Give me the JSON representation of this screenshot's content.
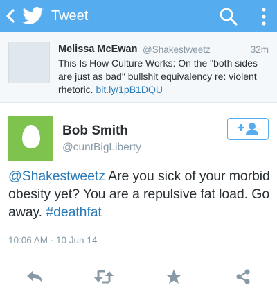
{
  "header": {
    "title": "Tweet",
    "color": "#55acee"
  },
  "parent_tweet": {
    "name": "Melissa McEwan",
    "handle": "@Shakestweetz",
    "time": "32m",
    "text": "This Is How Culture Works: On the \"both sides are just as bad\" bullshit equivalency re: violent rhetoric.",
    "link": "bit.ly/1pB1DQU"
  },
  "tweet": {
    "author": "Bob Smith",
    "handle": "@cuntBigLiberty",
    "mention": "@Shakestweetz",
    "text": "Are you sick of your morbid obesity yet?  You are a repulsive fat load.  Go away.",
    "hashtag": "#deathfat",
    "timestamp": "10:06 AM · 10 Jun 14"
  },
  "icons": {
    "back": "chevron-left-icon",
    "logo": "twitter-bird-icon",
    "search": "search-icon",
    "menu": "more-vertical-icon",
    "follow": "add-user-icon",
    "reply": "reply-icon",
    "retweet": "retweet-icon",
    "favorite": "star-icon",
    "share": "share-icon"
  },
  "colors": {
    "link": "#2b7bb9",
    "muted": "#8899a6",
    "action": "#8899a6",
    "avatar_bg": "#7dc34d"
  }
}
